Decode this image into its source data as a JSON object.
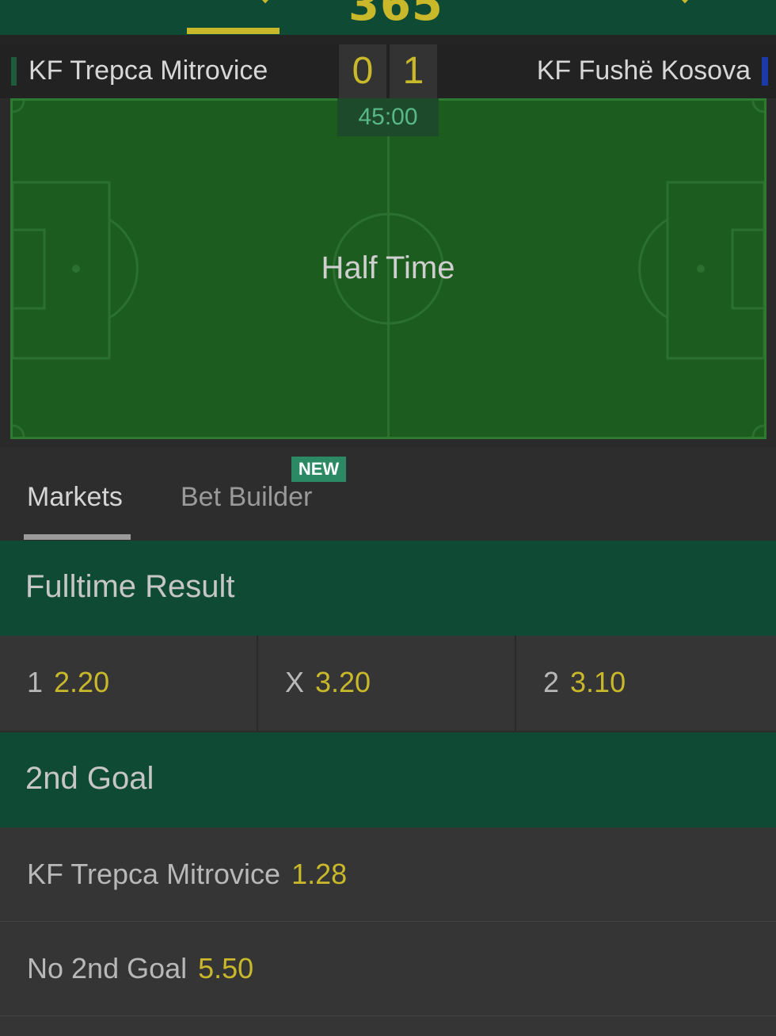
{
  "header": {
    "logo_text": "365"
  },
  "match": {
    "home_team": "KF Trepca Mitrovice",
    "away_team": "KF Fushë Kosova",
    "home_score": "0",
    "away_score": "1",
    "clock": "45:00",
    "status": "Half Time",
    "home_color": "#1e5b3a",
    "away_color": "#1a3aa8"
  },
  "tabs": {
    "markets": "Markets",
    "bet_builder": "Bet Builder",
    "new_badge": "NEW"
  },
  "markets": [
    {
      "title": "Fulltime Result",
      "selections": [
        {
          "label": "1",
          "price": "2.20"
        },
        {
          "label": "X",
          "price": "3.20"
        },
        {
          "label": "2",
          "price": "3.10"
        }
      ]
    },
    {
      "title": "2nd Goal",
      "selections": [
        {
          "label": "KF Trepca Mitrovice",
          "price": "1.28"
        },
        {
          "label": "No 2nd Goal",
          "price": "5.50"
        }
      ]
    }
  ],
  "colors": {
    "accent": "#c9b82a",
    "header_green": "#0f4a35",
    "pitch_green": "#1c5c1e"
  }
}
